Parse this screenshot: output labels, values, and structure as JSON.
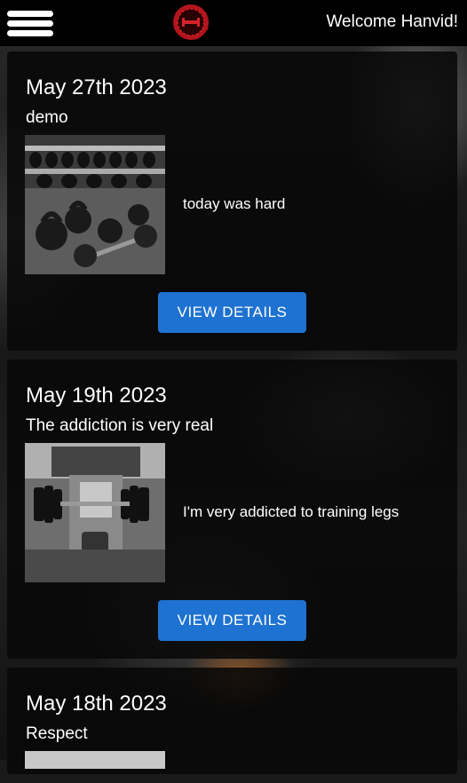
{
  "header": {
    "menu_icon": "hamburger-menu-icon",
    "logo_icon": "gym-logo-icon",
    "welcome_text": "Welcome Hanvid!"
  },
  "posts": [
    {
      "date": "May 27th 2023",
      "title": "demo",
      "text": "today was hard",
      "image": "kettlebells-dumbbells-photo",
      "button_label": "VIEW DETAILS"
    },
    {
      "date": "May 19th 2023",
      "title": "The addiction is very real",
      "text": "I'm very addicted to training legs",
      "image": "leg-press-machine-photo",
      "button_label": "VIEW DETAILS"
    },
    {
      "date": "May 18th 2023",
      "title": "Respect"
    }
  ],
  "colors": {
    "header_bg": "#000000",
    "card_bg": "#080808",
    "button_bg": "#1e72d1",
    "logo_red": "#b3151c"
  }
}
